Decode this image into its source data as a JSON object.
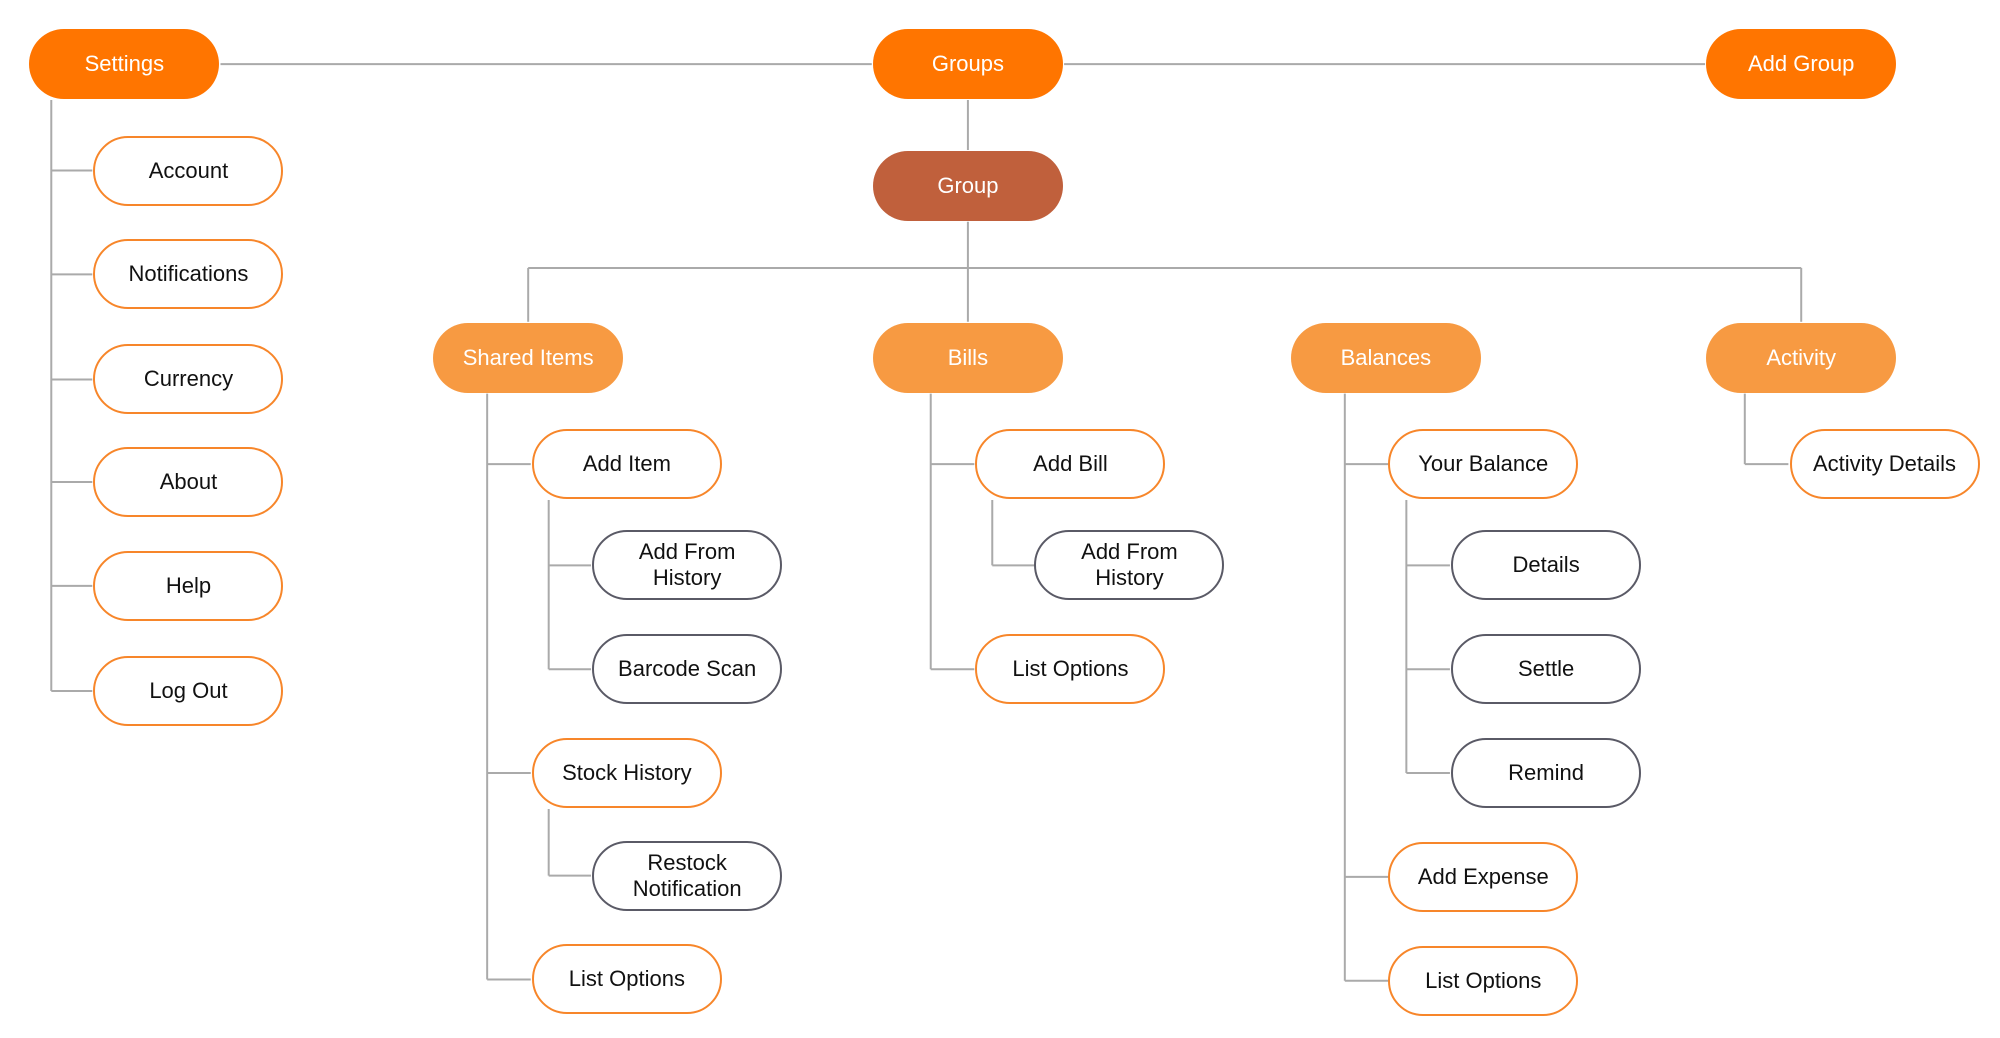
{
  "colors": {
    "primary": "#FF7500",
    "group": "#C0603C",
    "category": "#F79A42",
    "leaf_border": "#F7862A",
    "sub_border": "#5A5A66",
    "connector": "#AAAAAA"
  },
  "nodes": {
    "settings": "Settings",
    "groups": "Groups",
    "add_group": "Add Group",
    "group": "Group",
    "account": "Account",
    "notifications": "Notifications",
    "currency": "Currency",
    "about": "About",
    "help": "Help",
    "log_out": "Log Out",
    "shared_items": "Shared Items",
    "bills": "Bills",
    "balances": "Balances",
    "activity": "Activity",
    "add_item": "Add Item",
    "si_add_from_history": "Add From History",
    "barcode_scan": "Barcode Scan",
    "stock_history": "Stock History",
    "restock_notification": "Restock Notification",
    "si_list_options": "List Options",
    "add_bill": "Add Bill",
    "b_add_from_history": "Add From History",
    "b_list_options": "List Options",
    "your_balance": "Your Balance",
    "details": "Details",
    "settle": "Settle",
    "remind": "Remind",
    "add_expense": "Add Expense",
    "bal_list_options": "List Options",
    "activity_details": "Activity Details"
  }
}
